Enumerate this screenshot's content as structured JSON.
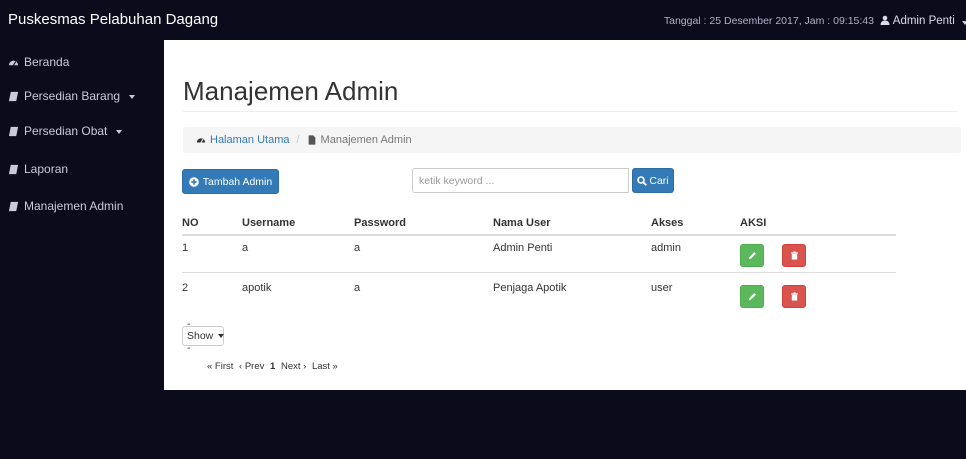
{
  "header": {
    "brand": "Puskesmas Pelabuhan Dagang",
    "datetime": "Tanggal : 25 Desember 2017, Jam : 09:15:43",
    "user": "Admin Penti"
  },
  "sidebar": {
    "items": [
      {
        "label": "Beranda",
        "icon": "dashboard-icon"
      },
      {
        "label": "Persedian Barang",
        "icon": "book-icon",
        "dropdown": true
      },
      {
        "label": "Persedian Obat",
        "icon": "book-icon",
        "dropdown": true
      },
      {
        "label": "Laporan",
        "icon": "book-icon"
      },
      {
        "label": "Manajemen Admin",
        "icon": "book-icon"
      }
    ]
  },
  "page": {
    "title": "Manajemen Admin",
    "breadcrumb": {
      "home": "Halaman Utama",
      "current": "Manajemen Admin"
    },
    "add_button": "Tambah Admin",
    "search_placeholder": "ketik keyword ...",
    "search_button": "Cari"
  },
  "table": {
    "columns": [
      "NO",
      "Username",
      "Password",
      "Nama User",
      "Akses",
      "AKSI"
    ],
    "rows": [
      [
        "1",
        "a",
        "a",
        "Admin Penti",
        "admin"
      ],
      [
        "2",
        "apotik",
        "a",
        "Penjaga Apotik",
        "user"
      ]
    ]
  },
  "show_select": "- Show -",
  "pagination": {
    "first": "« First",
    "prev": "‹ Prev",
    "current": "1",
    "next": "Next ›",
    "last": "Last »"
  },
  "colors": {
    "navbar": "#0b0b1c",
    "primary": "#337ab7",
    "success": "#5cb85c",
    "danger": "#d9534f"
  }
}
